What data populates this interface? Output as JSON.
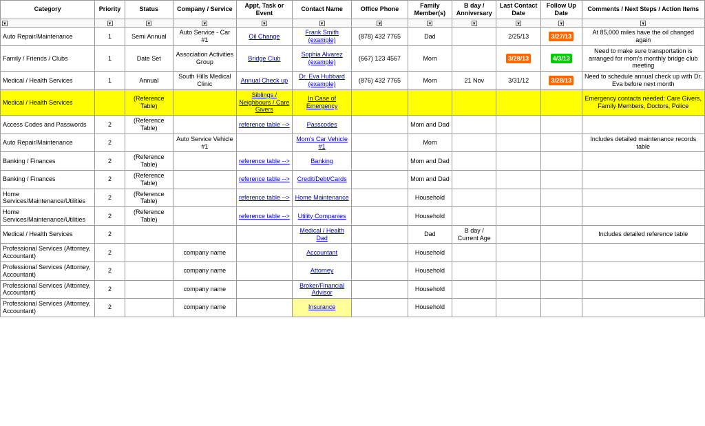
{
  "headers": {
    "category": "Category",
    "priority": "Priority",
    "status": "Status",
    "company": "Company / Service",
    "appt": "Appt, Task or Event",
    "contact": "Contact Name",
    "phone": "Office Phone",
    "family": "Family Member(s)",
    "bday": "B day / Anniversary",
    "lastcontact": "Last Contact Date",
    "followup": "Follow Up Date",
    "comments": "Comments / Next Steps / Action Items"
  },
  "rows": [
    {
      "category": "Auto Repair/Maintenance",
      "priority": "1",
      "status": "Semi Annual",
      "company": "Auto Service - Car #1",
      "appt": "Oil Change",
      "contact": "Frank Smith (example)",
      "phone": "(878) 432 7765",
      "family": "Dad",
      "bday": "",
      "lastcontact": "2/25/13",
      "followup": "3/27/13",
      "followup_class": "cell-orange",
      "comments": "At 85,000 miles have the oil changed again"
    },
    {
      "category": "Family / Friends / Clubs",
      "priority": "1",
      "status": "Date Set",
      "company": "Association Activities Group",
      "appt": "Bridge Club",
      "contact": "Sophia Alvarez (example)",
      "phone": "(667) 123 4567",
      "family": "Mom",
      "bday": "",
      "lastcontact": "3/28/13",
      "lastcontact_class": "cell-orange",
      "followup": "4/3/13",
      "followup_class": "cell-green",
      "comments": "Need to make sure transportation is arranged for mom's monthly bridge club meeting"
    },
    {
      "category": "Medical / Health Services",
      "priority": "1",
      "status": "Annual",
      "company": "South Hills Medical Clinic",
      "appt": "Annual Check up",
      "contact": "Dr. Eva Hubbard (example)",
      "phone": "(876) 432 7765",
      "family": "Mom",
      "bday": "21 Nov",
      "lastcontact": "3/31/12",
      "followup": "3/28/13",
      "followup_class": "cell-orange",
      "comments": "Need to schedule annual check up with Dr. Eva before next month"
    },
    {
      "category": "Medical / Health Services",
      "priority": "",
      "status": "(Reference Table)",
      "company": "",
      "appt": "Siblings / Neighbours / Care Givers",
      "contact": "In Case of Emergency",
      "phone": "",
      "family": "",
      "bday": "",
      "lastcontact": "",
      "followup": "",
      "comments": "Emergency contacts needed: Care Givers, Family Members, Doctors, Police",
      "row_class": "row-yellow"
    },
    {
      "category": "Access Codes and Passwords",
      "priority": "2",
      "status": "(Reference Table)",
      "company": "",
      "appt": "reference table -->",
      "contact": "Passcodes",
      "phone": "",
      "family": "Mom and Dad",
      "bday": "",
      "lastcontact": "",
      "followup": "",
      "comments": ""
    },
    {
      "category": "Auto Repair/Maintenance",
      "priority": "2",
      "status": "",
      "company": "Auto Service Vehicle #1",
      "appt": "",
      "contact": "Mom's Car Vehicle #1",
      "phone": "",
      "family": "Mom",
      "bday": "",
      "lastcontact": "",
      "followup": "",
      "comments": "Includes detailed maintenance records table"
    },
    {
      "category": "Banking / Finances",
      "priority": "2",
      "status": "(Reference Table)",
      "company": "",
      "appt": "reference table -->",
      "contact": "Banking",
      "phone": "",
      "family": "Mom and Dad",
      "bday": "",
      "lastcontact": "",
      "followup": "",
      "comments": ""
    },
    {
      "category": "Banking / Finances",
      "priority": "2",
      "status": "(Reference Table)",
      "company": "",
      "appt": "reference table -->",
      "contact": "Credit/Debt/Cards",
      "phone": "",
      "family": "Mom and Dad",
      "bday": "",
      "lastcontact": "",
      "followup": "",
      "comments": ""
    },
    {
      "category": "Home Services/Maintenance/Utilities",
      "priority": "2",
      "status": "(Reference Table)",
      "company": "",
      "appt": "reference table -->",
      "contact": "Home Maintenance",
      "phone": "",
      "family": "Household",
      "bday": "",
      "lastcontact": "",
      "followup": "",
      "comments": ""
    },
    {
      "category": "Home Services/Maintenance/Utilities",
      "priority": "2",
      "status": "(Reference Table)",
      "company": "",
      "appt": "reference table -->",
      "contact": "Utility Companies",
      "phone": "",
      "family": "Household",
      "bday": "",
      "lastcontact": "",
      "followup": "",
      "comments": ""
    },
    {
      "category": "Medical / Health Services",
      "priority": "2",
      "status": "",
      "company": "",
      "appt": "",
      "contact": "Medical / Health Dad",
      "phone": "",
      "family": "Dad",
      "bday": "B day / Current Age",
      "lastcontact": "",
      "followup": "",
      "comments": "Includes detailed reference table"
    },
    {
      "category": "Professional Services (Attorney, Accountant)",
      "priority": "2",
      "status": "",
      "company": "company name",
      "appt": "",
      "contact": "Accountant",
      "phone": "",
      "family": "Household",
      "bday": "",
      "lastcontact": "",
      "followup": "",
      "comments": ""
    },
    {
      "category": "Professional Services (Attorney, Accountant)",
      "priority": "2",
      "status": "",
      "company": "company name",
      "appt": "",
      "contact": "Attorney",
      "phone": "",
      "family": "Household",
      "bday": "",
      "lastcontact": "",
      "followup": "",
      "comments": ""
    },
    {
      "category": "Professional Services (Attorney, Accountant)",
      "priority": "2",
      "status": "",
      "company": "company name",
      "appt": "",
      "contact": "Broker/Financial Advisor",
      "phone": "",
      "family": "Household",
      "bday": "",
      "lastcontact": "",
      "followup": "",
      "comments": ""
    },
    {
      "category": "Professional Services (Attorney, Accountant)",
      "priority": "2",
      "status": "",
      "company": "company name",
      "appt": "",
      "contact": "Insurance",
      "phone": "",
      "family": "Household",
      "bday": "",
      "lastcontact": "",
      "followup": "",
      "comments": "",
      "contact_class": "cell-yellow-bg"
    }
  ]
}
